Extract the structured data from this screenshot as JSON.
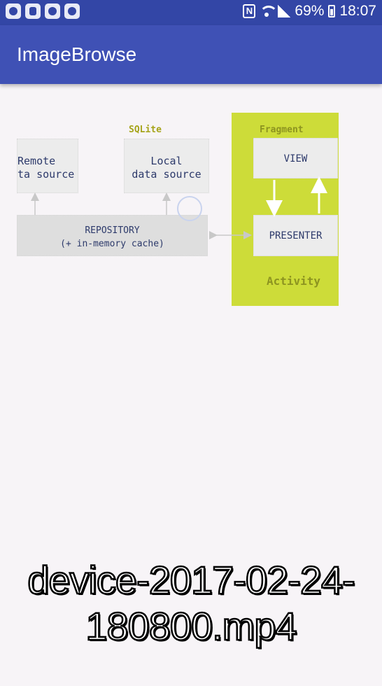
{
  "status_bar": {
    "notification_icons": [
      "paw-icon",
      "galaxy-apps-icon",
      "paw-icon",
      "paw-icon"
    ],
    "nfc": "N",
    "battery_percent": "69%",
    "time": "18:07"
  },
  "app_bar": {
    "title": "ImageBrowse"
  },
  "diagram": {
    "remote": {
      "line1": "Remote",
      "line2": "ta source"
    },
    "sqlite_label": "SQLite",
    "local": {
      "line1": "Local",
      "line2": "data source"
    },
    "repository": {
      "line1": "REPOSITORY",
      "line2": "(+ in-memory cache)"
    },
    "fragment_label": "Fragment",
    "view_label": "VIEW",
    "presenter_label": "PRESENTER",
    "activity_label": "Activity"
  },
  "overlay": {
    "line1": "device-2017-02-24-",
    "line2": "180800.mp4"
  },
  "colors": {
    "status_bar": "#3346a6",
    "app_bar": "#3f51b5",
    "activity": "#cddc39",
    "background": "#f7f4f7"
  }
}
